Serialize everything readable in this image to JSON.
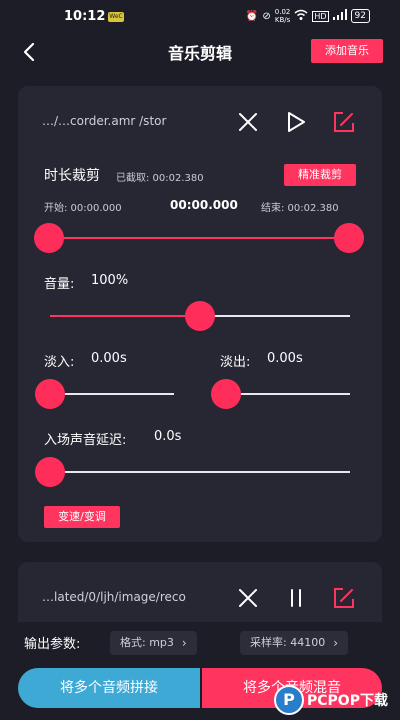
{
  "status_bar": {
    "time": "10:12",
    "mini_badge": "WeC",
    "net_top": "0.02",
    "net_bottom": "KB/s",
    "battery": "92"
  },
  "header": {
    "title": "音乐剪辑",
    "add_music_label": "添加音乐"
  },
  "track1": {
    "path": "…/…corder.amr          /stor",
    "trim": {
      "title": "时长裁剪",
      "captured": "已截取: 00:02.380",
      "precise_label": "精准裁剪",
      "start": "开始: 00:00.000",
      "current": "00:00.000",
      "end": "结束: 00:02.380",
      "start_fraction": 0.0,
      "end_fraction": 1.0
    },
    "volume": {
      "label": "音量:",
      "value": "100%",
      "fraction": 0.5
    },
    "fade_in": {
      "label": "淡入:",
      "value": "0.00s",
      "fraction": 0.0
    },
    "fade_out": {
      "label": "淡出:",
      "value": "0.00s",
      "fraction": 0.0
    },
    "delay": {
      "label": "入场声音延迟:",
      "value": "0.0s",
      "fraction": 0.0
    },
    "speed_button_label": "变速/变调"
  },
  "track2": {
    "path": "…lated/0/ljh/image/reco"
  },
  "output": {
    "label": "输出参数:",
    "format": "格式: mp3",
    "sample_rate": "采样率: 44100"
  },
  "actions": {
    "concat_label": "将多个音频拼接",
    "mix_label": "将多个音频混音"
  },
  "watermark": {
    "logo_letter": "P",
    "text": "PCPOP下载"
  },
  "colors": {
    "accent": "#ff3560",
    "background": "#1c1d26",
    "card": "#262733",
    "concat_button": "#3fa9d6"
  },
  "icons": {
    "back": "chevron-left-icon",
    "close": "close-icon",
    "play": "play-icon",
    "pause": "pause-icon",
    "edit": "edit-icon"
  }
}
